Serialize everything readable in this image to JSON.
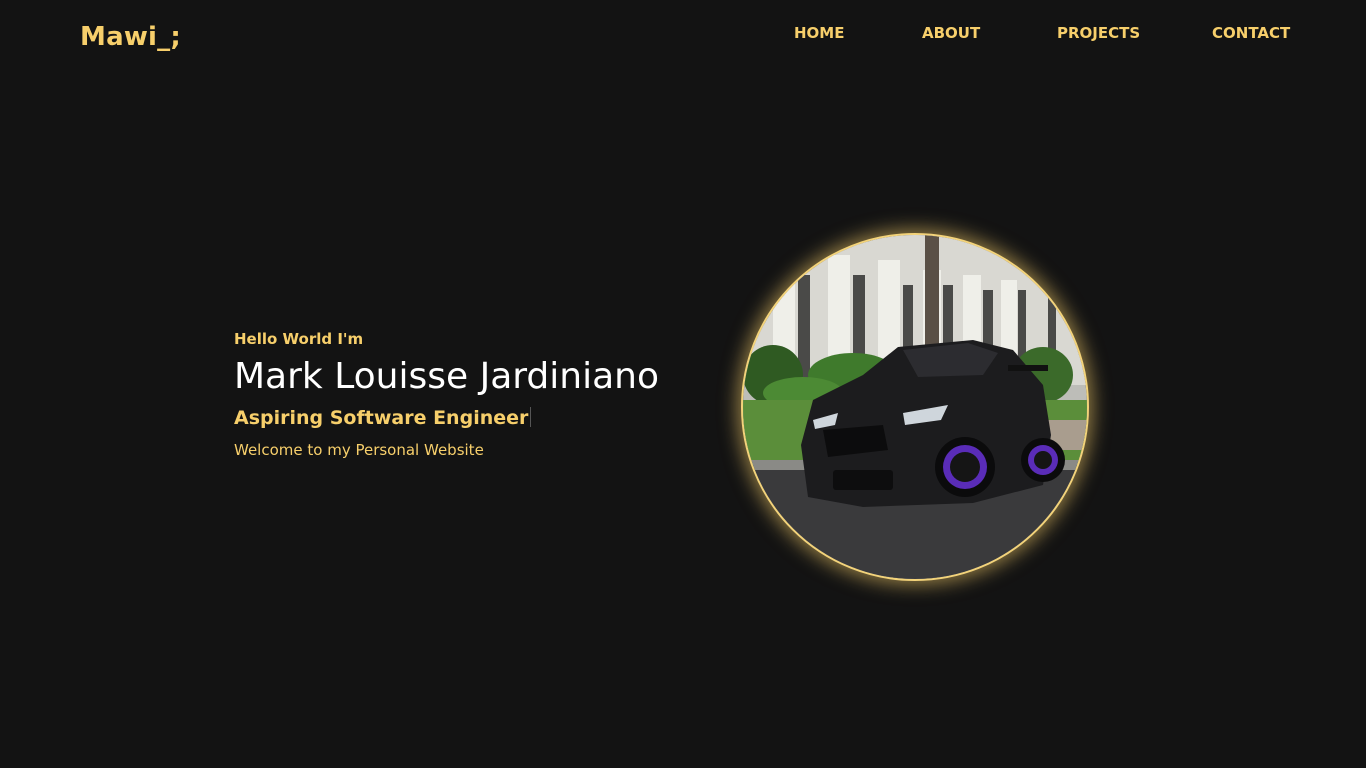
{
  "header": {
    "logo": "Mawi_;",
    "nav": [
      {
        "label": "HOME"
      },
      {
        "label": "ABOUT"
      },
      {
        "label": "PROJECTS"
      },
      {
        "label": "CONTACT"
      }
    ]
  },
  "hero": {
    "greeting": "Hello World I'm",
    "name": "Mark Louisse Jardiniano",
    "role": "Aspiring Software Engineer",
    "welcome": "Welcome to my Personal Website",
    "photo": {
      "description_icon": "profile-photo-car",
      "ring_color": "#f3d37a"
    }
  },
  "colors": {
    "background": "#131313",
    "accent": "#f7cf6b",
    "heading": "#ffffff"
  }
}
